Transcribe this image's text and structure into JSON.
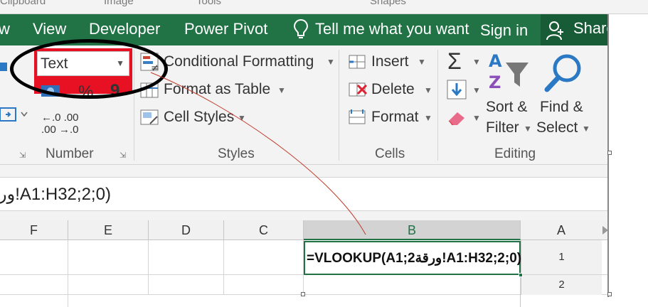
{
  "top_groups": [
    "Clipboard",
    "Image",
    "Tools",
    "Shapes"
  ],
  "tabs": {
    "view": "w",
    "view2": "View",
    "developer": "Developer",
    "power_pivot": "Power Pivot",
    "tell_me": "Tell me what you want",
    "sign_in": "Sign in",
    "share": "Share"
  },
  "ribbon": {
    "number_format": "Text",
    "percent": "%",
    "comma": "9",
    "inc_dec_top": "←.0  .00",
    "inc_dec_bot": ".00  →.0",
    "conditional_formatting": "Conditional Formatting",
    "format_as_table": "Format as Table",
    "cell_styles": "Cell Styles",
    "insert": "Insert",
    "delete": "Delete",
    "format": "Format",
    "sort_filter_1": "Sort &",
    "sort_filter_2": "Filter",
    "find_select_1": "Find &",
    "find_select_2": "Select",
    "groups": {
      "number": "Number",
      "styles": "Styles",
      "cells": "Cells",
      "editing": "Editing"
    }
  },
  "formula_bar": {
    "text": "ور!A1:H32;2;0)"
  },
  "columns": [
    "F",
    "E",
    "D",
    "C",
    "B",
    "A"
  ],
  "rows": [
    "1",
    "2"
  ],
  "active_cell_content": "=VLOOKUP(A1;2ورقة!A1:H32;2;0)",
  "colors": {
    "excel_green": "#217346",
    "highlight_red": "#e81123"
  }
}
